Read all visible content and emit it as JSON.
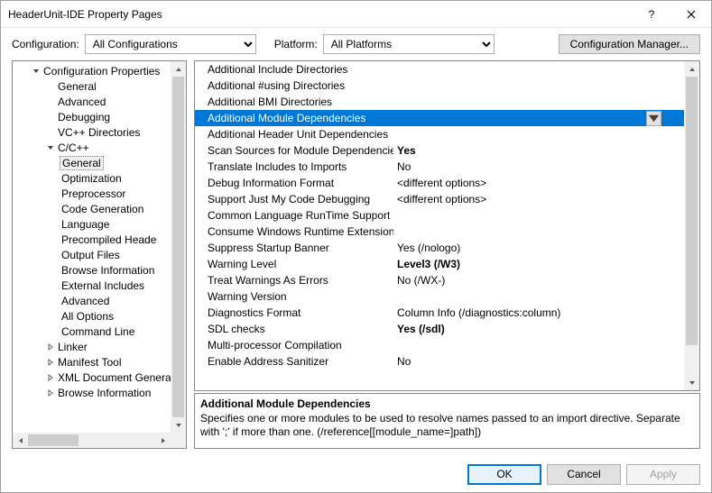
{
  "titlebar": {
    "title": "HeaderUnit-IDE Property Pages",
    "help_tooltip": "?",
    "close_tooltip": "Close"
  },
  "config_row": {
    "config_label": "Configuration:",
    "config_value": "All Configurations",
    "platform_label": "Platform:",
    "platform_value": "All Platforms",
    "cfg_mgr_label": "Configuration Manager..."
  },
  "tree": [
    {
      "lvl": 1,
      "arrow": "down",
      "label": "Configuration Properties"
    },
    {
      "lvl": 2,
      "arrow": "",
      "label": "General"
    },
    {
      "lvl": 2,
      "arrow": "",
      "label": "Advanced"
    },
    {
      "lvl": 2,
      "arrow": "",
      "label": "Debugging"
    },
    {
      "lvl": 2,
      "arrow": "",
      "label": "VC++ Directories"
    },
    {
      "lvl": 2,
      "arrow": "down",
      "label": "C/C++"
    },
    {
      "lvl": 3,
      "arrow": "",
      "label": "General",
      "sel": true
    },
    {
      "lvl": 3,
      "arrow": "",
      "label": "Optimization"
    },
    {
      "lvl": 3,
      "arrow": "",
      "label": "Preprocessor"
    },
    {
      "lvl": 3,
      "arrow": "",
      "label": "Code Generation"
    },
    {
      "lvl": 3,
      "arrow": "",
      "label": "Language"
    },
    {
      "lvl": 3,
      "arrow": "",
      "label": "Precompiled Heade"
    },
    {
      "lvl": 3,
      "arrow": "",
      "label": "Output Files"
    },
    {
      "lvl": 3,
      "arrow": "",
      "label": "Browse Information"
    },
    {
      "lvl": 3,
      "arrow": "",
      "label": "External Includes"
    },
    {
      "lvl": 3,
      "arrow": "",
      "label": "Advanced"
    },
    {
      "lvl": 3,
      "arrow": "",
      "label": "All Options"
    },
    {
      "lvl": 3,
      "arrow": "",
      "label": "Command Line"
    },
    {
      "lvl": 2,
      "arrow": "right",
      "label": "Linker"
    },
    {
      "lvl": 2,
      "arrow": "right",
      "label": "Manifest Tool"
    },
    {
      "lvl": 2,
      "arrow": "right",
      "label": "XML Document Genera"
    },
    {
      "lvl": 2,
      "arrow": "right",
      "label": "Browse Information"
    }
  ],
  "props": [
    {
      "name": "Additional Include Directories",
      "value": ""
    },
    {
      "name": "Additional #using Directories",
      "value": ""
    },
    {
      "name": "Additional BMI Directories",
      "value": ""
    },
    {
      "name": "Additional Module Dependencies",
      "value": "",
      "selected": true
    },
    {
      "name": "Additional Header Unit Dependencies",
      "value": ""
    },
    {
      "name": "Scan Sources for Module Dependencies",
      "value": "Yes",
      "bold": true
    },
    {
      "name": "Translate Includes to Imports",
      "value": "No"
    },
    {
      "name": "Debug Information Format",
      "value": "<different options>"
    },
    {
      "name": "Support Just My Code Debugging",
      "value": "<different options>"
    },
    {
      "name": "Common Language RunTime Support",
      "value": ""
    },
    {
      "name": "Consume Windows Runtime Extension",
      "value": ""
    },
    {
      "name": "Suppress Startup Banner",
      "value": "Yes (/nologo)"
    },
    {
      "name": "Warning Level",
      "value": "Level3 (/W3)",
      "bold": true
    },
    {
      "name": "Treat Warnings As Errors",
      "value": "No (/WX-)"
    },
    {
      "name": "Warning Version",
      "value": ""
    },
    {
      "name": "Diagnostics Format",
      "value": "Column Info (/diagnostics:column)"
    },
    {
      "name": "SDL checks",
      "value": "Yes (/sdl)",
      "bold": true
    },
    {
      "name": "Multi-processor Compilation",
      "value": ""
    },
    {
      "name": "Enable Address Sanitizer",
      "value": "No"
    }
  ],
  "desc": {
    "title": "Additional Module Dependencies",
    "body": "Specifies one or more modules to be used to resolve names passed to an import directive. Separate with ';' if more than one.  (/reference[[module_name=]path])"
  },
  "footer": {
    "ok": "OK",
    "cancel": "Cancel",
    "apply": "Apply"
  }
}
